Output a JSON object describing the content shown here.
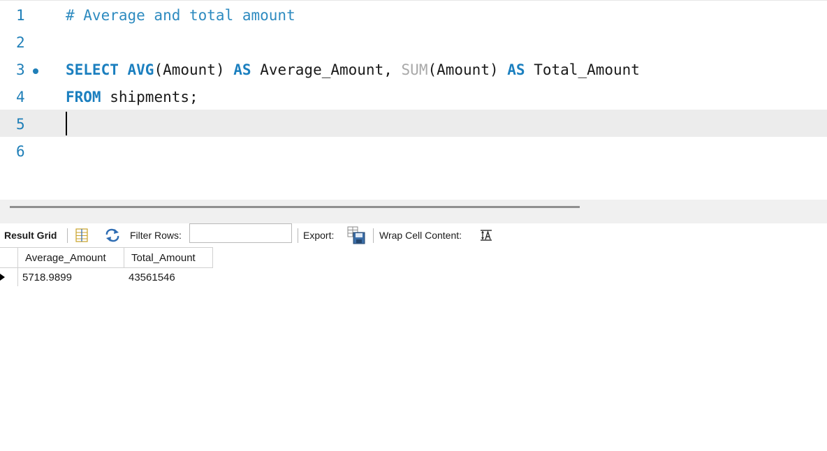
{
  "editor": {
    "lines": [
      {
        "number": "1",
        "comment": "# Average and total amount"
      },
      {
        "number": "2"
      },
      {
        "number": "3",
        "kw_select": "SELECT",
        "fn_avg": "AVG",
        "avg_arg": "(Amount)",
        "kw_as1": "AS",
        "alias1": "Average_Amount,",
        "fn_sum": "SUM",
        "sum_arg": "(Amount)",
        "kw_as2": "AS",
        "alias2": "Total_Amount"
      },
      {
        "number": "4",
        "kw_from": "FROM",
        "table": "shipments;"
      },
      {
        "number": "5"
      },
      {
        "number": "6"
      }
    ]
  },
  "result_toolbar": {
    "result_grid_label": "Result Grid",
    "filter_label": "Filter Rows:",
    "filter_value": "",
    "export_label": "Export:",
    "wrap_label": "Wrap Cell Content:",
    "icons": [
      "grid-layout-icon",
      "refresh-icon",
      "export-icon",
      "wrap-text-icon"
    ]
  },
  "result_grid": {
    "columns": [
      "Average_Amount",
      "Total_Amount"
    ],
    "rows": [
      [
        "5718.9899",
        "43561546"
      ]
    ]
  },
  "colors": {
    "keyword": "#1b7fbf",
    "comment": "#2e8bc0",
    "line_number": "#1f7fb8",
    "current_line": "#ececec"
  }
}
